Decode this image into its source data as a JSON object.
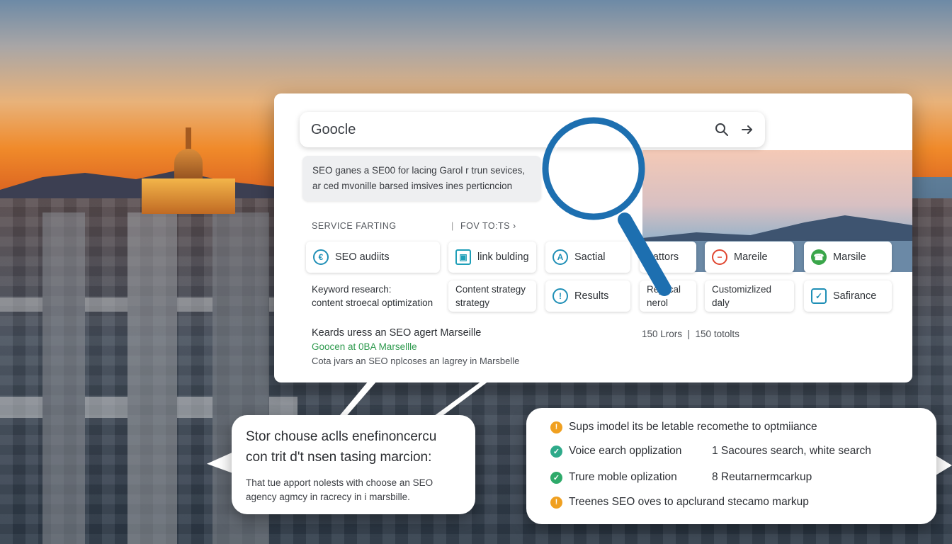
{
  "search": {
    "query": "Goocle"
  },
  "snippet": {
    "line1": "SEO ganes a SE00 for lacing Garol r trun sevices,",
    "line2": "ar ced mvonille barsed imsives ines perticncion"
  },
  "filters": {
    "left": "SERVICE FARTING",
    "right": "FOV TO:TS ›"
  },
  "chips_row1": [
    {
      "label": "SEO audiits",
      "icon": "seo-badge-icon",
      "color": "#1f8fb6",
      "glyph": "€"
    },
    {
      "label": "link bulding",
      "icon": "monitor-chat-icon",
      "color": "#1f9fb8",
      "glyph": "▣"
    },
    {
      "label": "Sactial",
      "icon": "compass-icon",
      "color": "#1f8fb6",
      "glyph": "A"
    },
    {
      "label": "rtattors",
      "icon": "",
      "color": "",
      "glyph": ""
    },
    {
      "label": "Mareile",
      "icon": "no-entry-icon",
      "color": "#e0452f",
      "glyph": "−"
    },
    {
      "label": "Marsile",
      "icon": "phone-icon",
      "color": "#3aa64a",
      "glyph": "☎"
    }
  ],
  "chips_row2": [
    {
      "line1": "Keyword research:",
      "line2": "content stroecal optimization"
    },
    {
      "line1": "Content strategy",
      "line2": "strategy"
    },
    {
      "label": "Results",
      "icon": "info-icon",
      "color": "#1f8fb6",
      "glyph": "!"
    },
    {
      "line1": "Reytical",
      "line2": "nerol"
    },
    {
      "line1": "Customizlized",
      "line2": "daly"
    },
    {
      "label": "Safirance",
      "icon": "shield-check-icon",
      "color": "#1f8fb6",
      "glyph": "✓"
    }
  ],
  "result": {
    "title": "Keards uress an SEO agert Marseille",
    "url": "Goocen at 0BA Marsellle",
    "desc": "Cota jvars an SEO nplcoses an lagrey in Marsbelle",
    "count": "150 Lrors  |  150 totolts"
  },
  "callout_left": {
    "heading1": "Stor chouse aclls enefinoncercu",
    "heading2": "con trit d't nsen tasing marcion:",
    "body1": "That tue apport nolests with choose an SEO",
    "body2": "agency agmcy in racrecy in i marsbille."
  },
  "callout_right": {
    "items": [
      {
        "text": "Sups imodel its be letable recomethe to optmiiance",
        "icon": "warning-icon",
        "color": "#f0a020"
      },
      {
        "text": "Voice earch opplization",
        "icon": "check-icon",
        "color": "#2eaa8a",
        "extra": "1 Sacoures search, white search"
      },
      {
        "text": "Trure moble oplization",
        "icon": "check-icon",
        "color": "#2eaa6a",
        "extra": "8 Reutarnermcarkup"
      },
      {
        "text": "Treenes SEO oves to apclurand stecamo markup",
        "icon": "warning-icon",
        "color": "#f0a020"
      }
    ]
  }
}
